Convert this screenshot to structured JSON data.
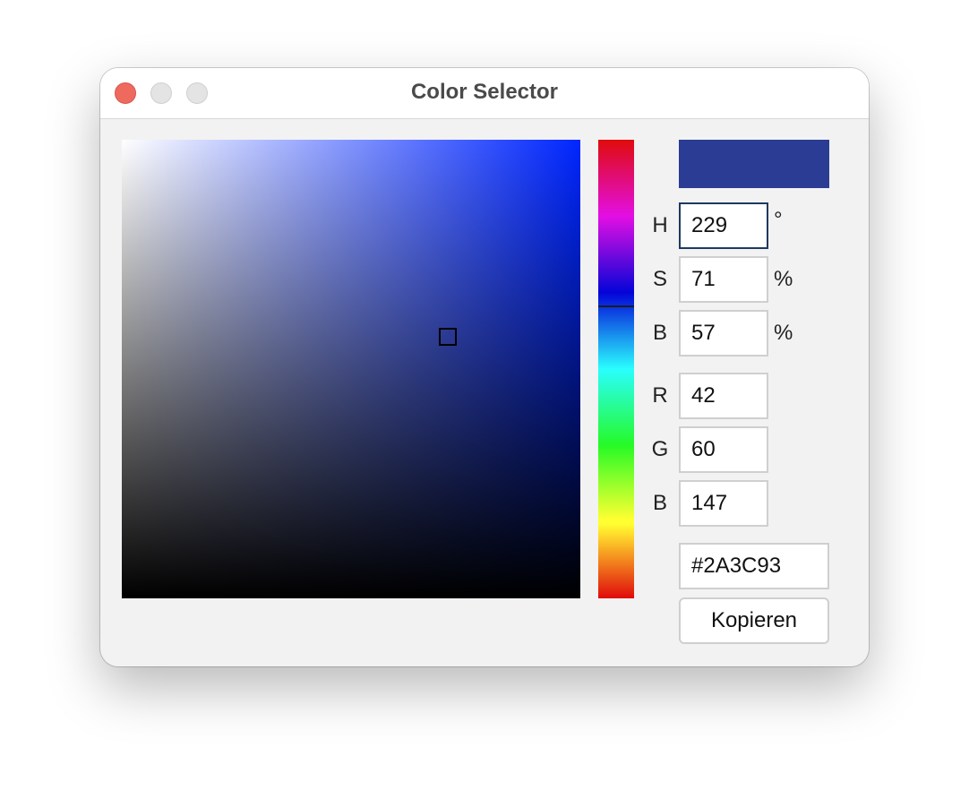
{
  "window": {
    "title": "Color Selector"
  },
  "colors": {
    "selected": "#2A3C93",
    "hue_pure": "#0026ff"
  },
  "picker": {
    "saturation_percent": 71,
    "brightness_percent": 57,
    "hue_degrees": 229
  },
  "fields": {
    "h": {
      "label": "H",
      "value": "229",
      "unit": "°"
    },
    "s": {
      "label": "S",
      "value": "71",
      "unit": "%"
    },
    "b": {
      "label": "B",
      "value": "57",
      "unit": "%"
    },
    "r": {
      "label": "R",
      "value": "42"
    },
    "g": {
      "label": "G",
      "value": "60"
    },
    "bl": {
      "label": "B",
      "value": "147"
    },
    "hex": {
      "value": "#2A3C93"
    }
  },
  "copy_button": {
    "label": "Kopieren"
  },
  "icons": {
    "close": "close-icon",
    "minimize": "minimize-icon",
    "zoom": "zoom-icon"
  }
}
